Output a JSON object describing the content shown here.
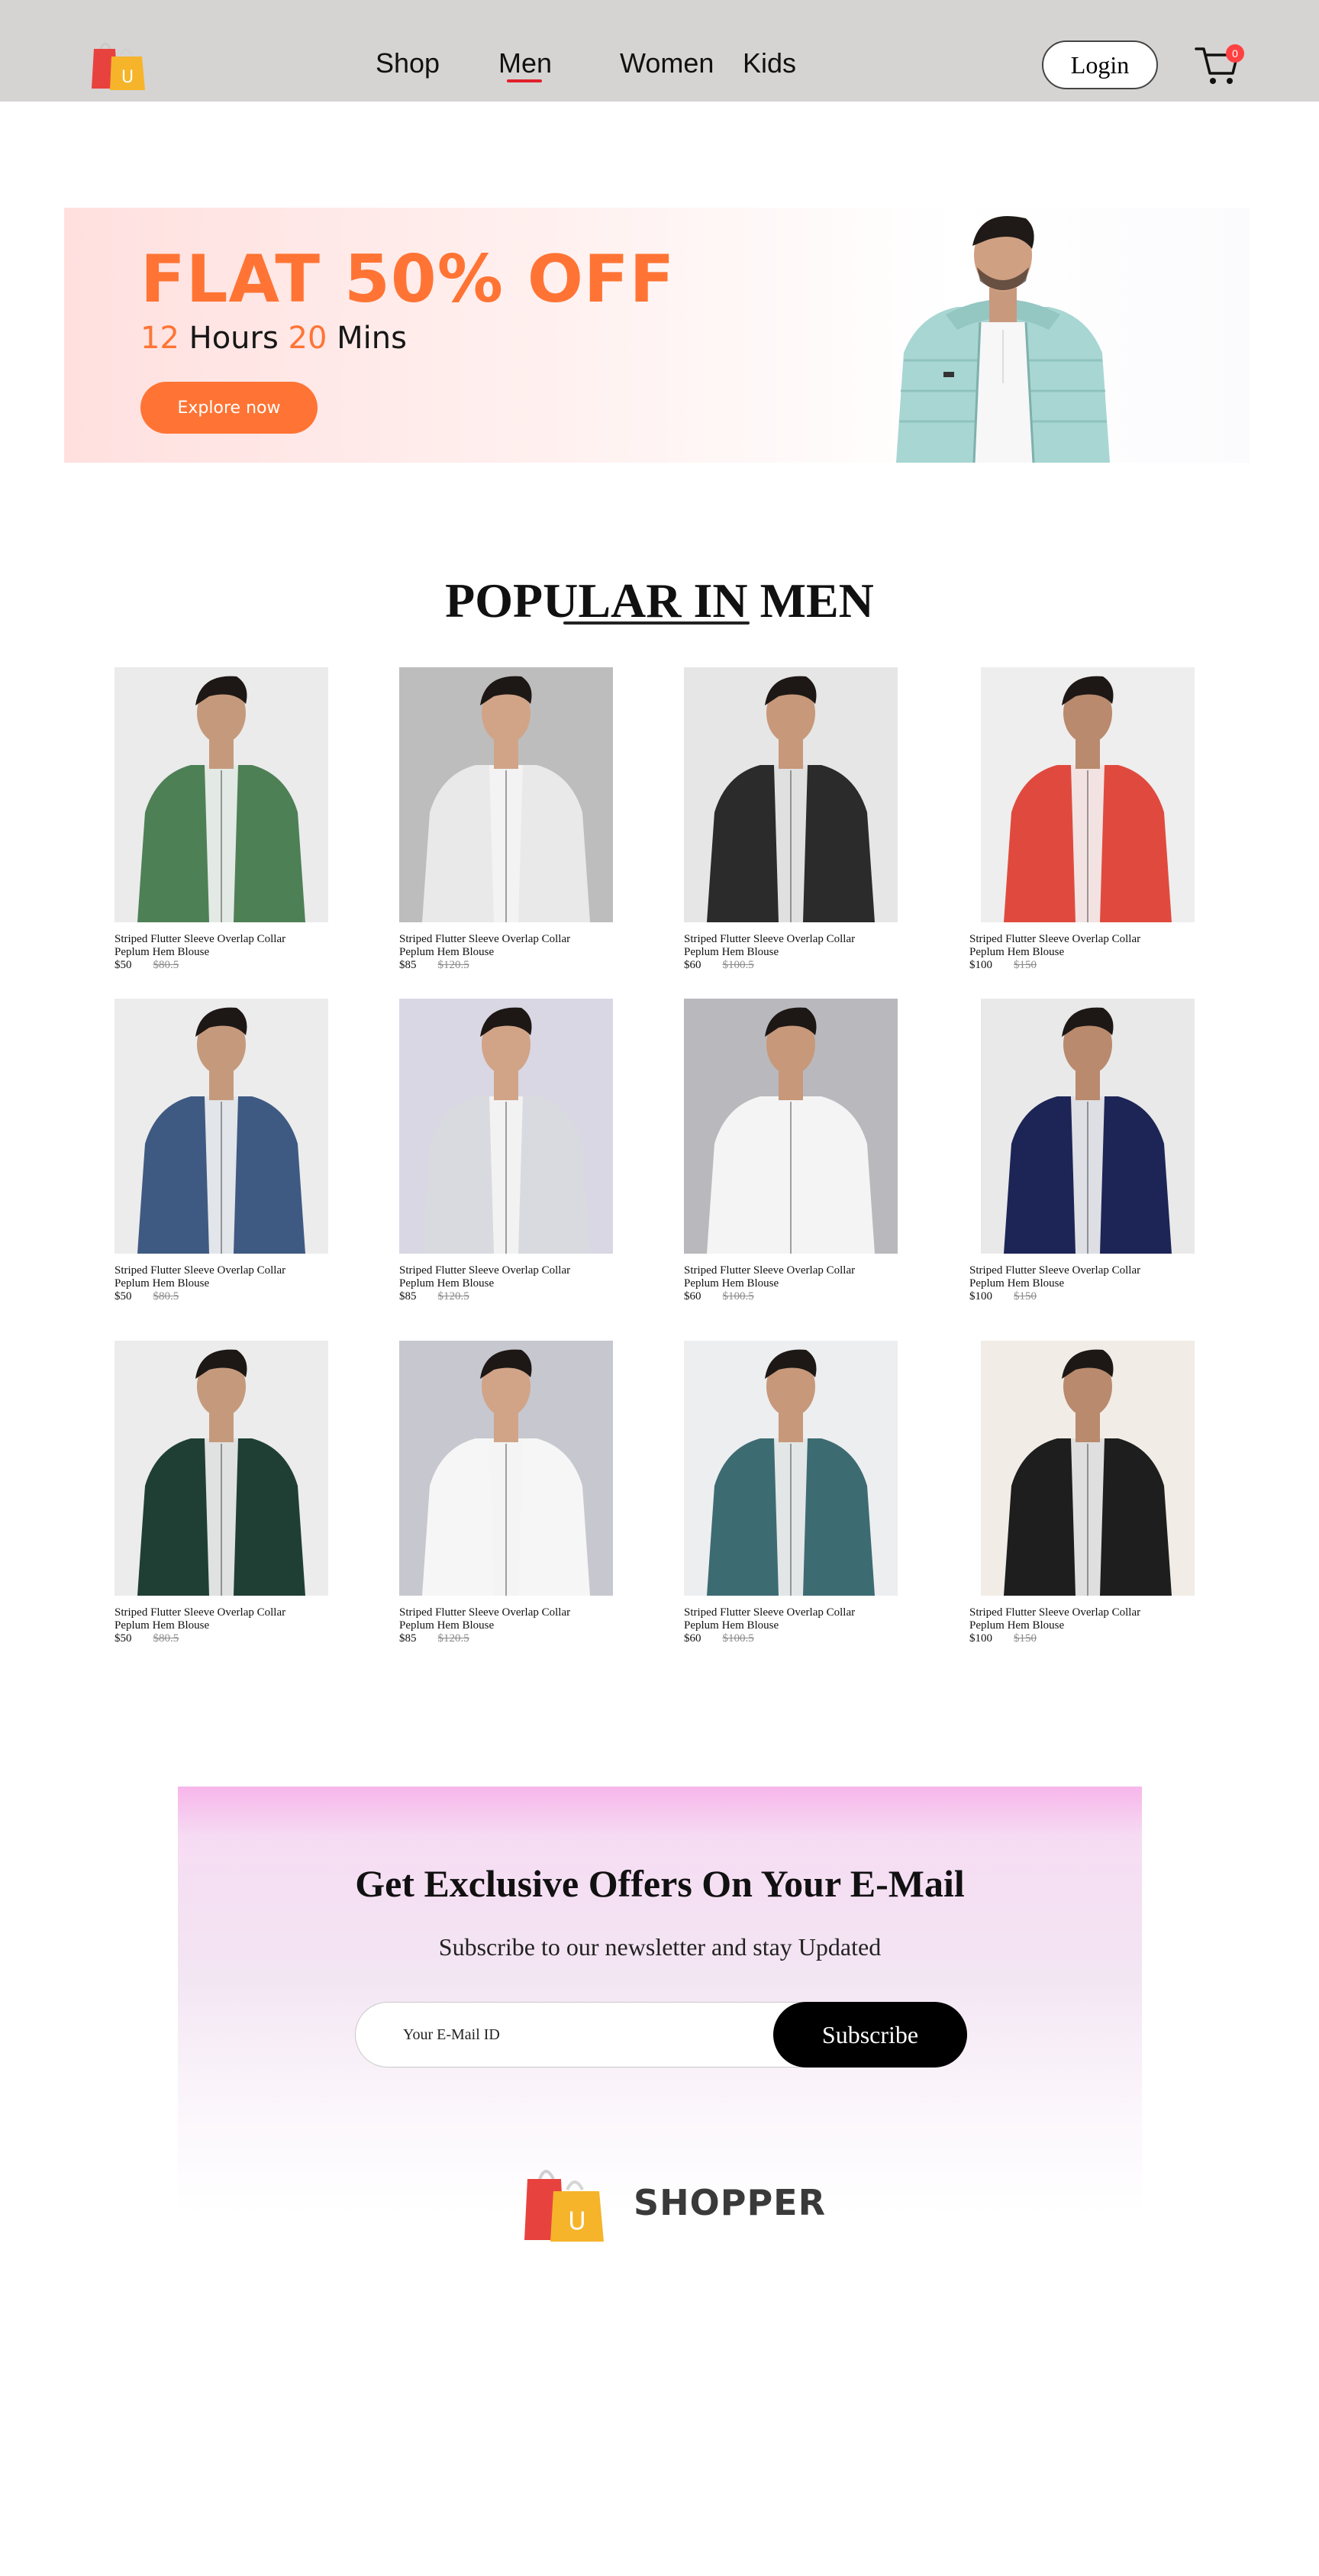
{
  "nav": {
    "links": [
      "Shop",
      "Men",
      "Women",
      "Kids"
    ],
    "active": "Men",
    "login_label": "Login",
    "cart_count": "0",
    "logo_letter": "U"
  },
  "hero": {
    "title": "FLAT 50% OFF",
    "hours": "12",
    "hours_label": "Hours",
    "mins": "20",
    "mins_label": "Mins",
    "button_label": "Explore now"
  },
  "popular": {
    "title": "POPULAR IN MEN",
    "products": [
      {
        "name": "Striped Flutter Sleeve Overlap Collar Peplum Hem Blouse",
        "new_price": "$50",
        "old_price": "$80.5",
        "jacket": "#4e8056",
        "bg": "#ebebeb",
        "icon": "green-hoodie-photo"
      },
      {
        "name": "Striped Flutter Sleeve Overlap Collar Peplum Hem Blouse",
        "new_price": "$85",
        "old_price": "$120.5",
        "jacket": "#e9e9e9",
        "bg": "#bdbdbd",
        "icon": "white-navy-puffer-photo"
      },
      {
        "name": "Striped Flutter Sleeve Overlap Collar Peplum Hem Blouse",
        "new_price": "$60",
        "old_price": "$100.5",
        "jacket": "#2b2b2b",
        "bg": "#e6e6e6",
        "icon": "black-marble-jacket-photo"
      },
      {
        "name": "Striped Flutter Sleeve Overlap Collar Peplum Hem Blouse",
        "new_price": "$100",
        "old_price": "$150",
        "jacket": "#e04a3e",
        "bg": "#eeeeee",
        "icon": "red-active-jacket-photo"
      },
      {
        "name": "Striped Flutter Sleeve Overlap Collar Peplum Hem Blouse",
        "new_price": "$50",
        "old_price": "$80.5",
        "jacket": "#3f5a82",
        "bg": "#ececec",
        "icon": "denim-jacket-photo"
      },
      {
        "name": "Striped Flutter Sleeve Overlap Collar Peplum Hem Blouse",
        "new_price": "$85",
        "old_price": "$120.5",
        "jacket": "#d9dadf",
        "bg": "#d9d7e3",
        "icon": "grey-zip-jacket-photo"
      },
      {
        "name": "Striped Flutter Sleeve Overlap Collar Peplum Hem Blouse",
        "new_price": "$60",
        "old_price": "$100.5",
        "jacket": "#f4f4f4",
        "bg": "#b9b9bd",
        "icon": "white-windbreaker-photo"
      },
      {
        "name": "Striped Flutter Sleeve Overlap Collar Peplum Hem Blouse",
        "new_price": "$100",
        "old_price": "$150",
        "jacket": "#1d2556",
        "bg": "#e9e9e9",
        "icon": "navy-fleece-jacket-photo"
      },
      {
        "name": "Striped Flutter Sleeve Overlap Collar Peplum Hem Blouse",
        "new_price": "$50",
        "old_price": "$80.5",
        "jacket": "#1f3f35",
        "bg": "#ececec",
        "icon": "colorblock-jacket-photo"
      },
      {
        "name": "Striped Flutter Sleeve Overlap Collar Peplum Hem Blouse",
        "new_price": "$85",
        "old_price": "$120.5",
        "jacket": "#f6f6f6",
        "bg": "#c7c7cf",
        "icon": "white-hooded-jacket-photo"
      },
      {
        "name": "Striped Flutter Sleeve Overlap Collar Peplum Hem Blouse",
        "new_price": "$60",
        "old_price": "$100.5",
        "jacket": "#3d6b72",
        "bg": "#eceef0",
        "icon": "teal-jacket-yellow-hoodie-photo"
      },
      {
        "name": "Striped Flutter Sleeve Overlap Collar Peplum Hem Blouse",
        "new_price": "$100",
        "old_price": "$150",
        "jacket": "#1e1e1e",
        "bg": "#f1ece6",
        "icon": "black-leather-jacket-photo"
      }
    ]
  },
  "newsletter": {
    "title": "Get Exclusive Offers On Your E-Mail",
    "subtitle": "Subscribe to our newsletter and stay Updated",
    "placeholder": "Your E-Mail ID",
    "button_label": "Subscribe"
  },
  "footer": {
    "brand": "SHOPPER",
    "logo_letter": "U"
  },
  "colors": {
    "accent": "#ff7434",
    "nav_bg": "#d6d3d3",
    "underline": "#e0202a",
    "cart_badge": "#ff4141"
  }
}
